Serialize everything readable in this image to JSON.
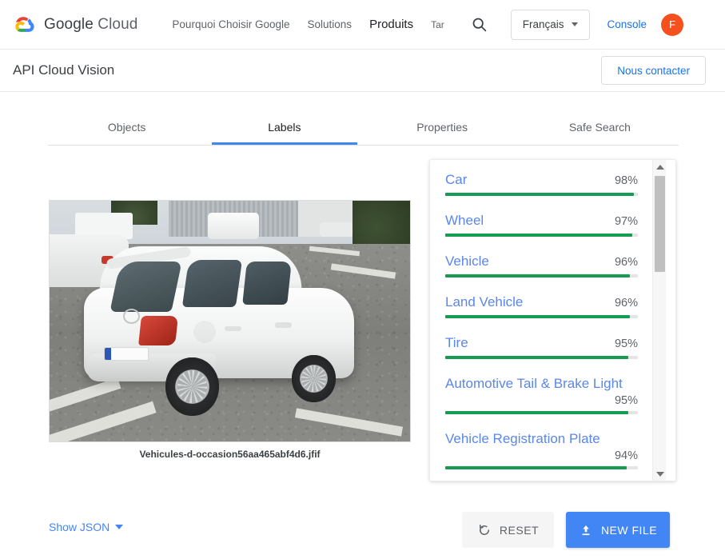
{
  "topnav": {
    "brand_google": "Google",
    "brand_cloud": "Cloud",
    "links": [
      {
        "label": "Pourquoi Choisir Google",
        "active": false
      },
      {
        "label": "Solutions",
        "active": false
      },
      {
        "label": "Produits",
        "active": true
      },
      {
        "label": "Tar",
        "active": false
      }
    ],
    "search_icon": "search-icon",
    "language": "Français",
    "console": "Console",
    "avatar_initial": "F"
  },
  "subheader": {
    "title": "API Cloud Vision",
    "contact_label": "Nous contacter"
  },
  "tabs": [
    {
      "label": "Objects",
      "active": false
    },
    {
      "label": "Labels",
      "active": true
    },
    {
      "label": "Properties",
      "active": false
    },
    {
      "label": "Safe Search",
      "active": false
    }
  ],
  "image": {
    "filename": "Vehicules-d-occasion56aa465abf4d6.jfif",
    "alt": "White Volkswagen Polo hatchback parked in a parking lot"
  },
  "labels": [
    {
      "name": "Car",
      "percent": "98%",
      "value": 98,
      "wrapped": false
    },
    {
      "name": "Wheel",
      "percent": "97%",
      "value": 97,
      "wrapped": false
    },
    {
      "name": "Vehicle",
      "percent": "96%",
      "value": 96,
      "wrapped": false
    },
    {
      "name": "Land Vehicle",
      "percent": "96%",
      "value": 96,
      "wrapped": false
    },
    {
      "name": "Tire",
      "percent": "95%",
      "value": 95,
      "wrapped": false
    },
    {
      "name": "Automotive Tail & Brake Light",
      "percent": "95%",
      "value": 95,
      "wrapped": true
    },
    {
      "name": "Vehicle Registration Plate",
      "percent": "94%",
      "value": 94,
      "wrapped": true
    }
  ],
  "footer": {
    "show_json": "Show JSON",
    "reset_label": "RESET",
    "newfile_label": "NEW FILE"
  },
  "colors": {
    "accent_blue": "#4285f4",
    "link_blue": "#1a73e8",
    "label_blue": "#5b87e8",
    "bar_green": "#169b53",
    "avatar_orange": "#f4511e"
  }
}
